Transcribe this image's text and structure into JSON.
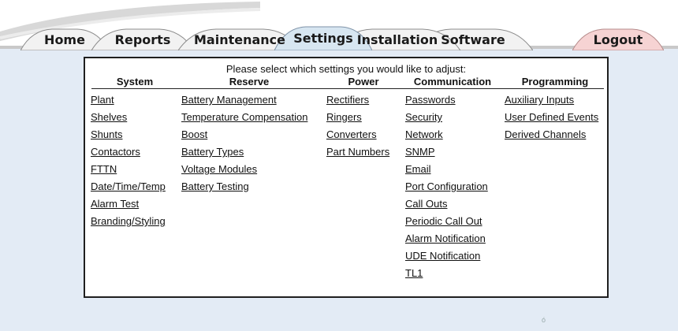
{
  "nav": {
    "tabs": [
      {
        "label": "Home"
      },
      {
        "label": "Reports"
      },
      {
        "label": "Maintenance"
      },
      {
        "label": "Settings",
        "active": true
      },
      {
        "label": "Installation"
      },
      {
        "label": "Software"
      }
    ],
    "logout": "Logout"
  },
  "panel": {
    "prompt": "Please select which settings you would like to adjust:",
    "columns": [
      {
        "heading": "System",
        "links": [
          "Plant",
          "Shelves",
          "Shunts",
          "Contactors",
          "FTTN",
          "Date/Time/Temp",
          "Alarm Test",
          "Branding/Styling"
        ]
      },
      {
        "heading": "Reserve",
        "links": [
          "Battery Management",
          "Temperature Compensation",
          "Boost",
          "Battery Types",
          "Voltage Modules",
          "Battery Testing"
        ]
      },
      {
        "heading": "Power",
        "links": [
          "Rectifiers",
          "Ringers",
          "Converters",
          "Part Numbers"
        ]
      },
      {
        "heading": "Communication",
        "links": [
          "Passwords",
          "Security",
          "Network",
          "SNMP",
          "Email",
          "Port Configuration",
          "Call Outs",
          "Periodic Call Out",
          "Alarm Notification",
          "UDE Notification",
          "TL1"
        ]
      },
      {
        "heading": "Programming",
        "links": [
          "Auxiliary Inputs",
          "User Defined Events",
          "Derived Channels"
        ]
      }
    ]
  },
  "footer_mark": "ó",
  "colors": {
    "page_bg": "#e3ebf5",
    "tab_active": "#d7e6f1",
    "tab_logout": "#f6d3d3",
    "panel_border": "#1f1f1f"
  }
}
